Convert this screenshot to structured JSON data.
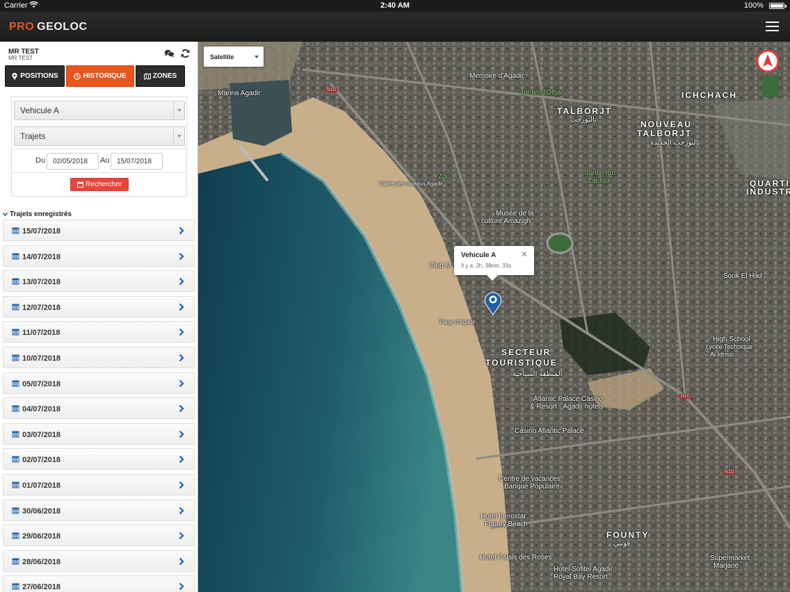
{
  "status_bar": {
    "carrier": "Carrier",
    "time": "2:40 AM",
    "battery": "100%"
  },
  "header": {
    "logo_pro": "PRO",
    "logo_geoloc": "GEOLOC"
  },
  "user": {
    "name": "MR TEST",
    "subname": "MR TEST"
  },
  "tabs": [
    {
      "label": "POSITIONS",
      "icon": "map-pin-icon"
    },
    {
      "label": "HISTORIQUE",
      "icon": "clock-icon",
      "active": true
    },
    {
      "label": "ZONES",
      "icon": "map-icon"
    }
  ],
  "filters": {
    "vehicle": "Vehicule A",
    "mode": "Trajets",
    "from_label": "Du",
    "from_value": "02/05/2018",
    "to_label": "Au",
    "to_value": "15/07/2018",
    "search_label": "Rechercher"
  },
  "trips": {
    "header": "Trajets enregistrés",
    "items": [
      "15/07/2018",
      "14/07/2018",
      "13/07/2018",
      "12/07/2018",
      "11/07/2018",
      "10/07/2018",
      "05/07/2018",
      "04/07/2018",
      "03/07/2018",
      "02/07/2018",
      "01/07/2018",
      "30/06/2018",
      "29/06/2018",
      "28/06/2018",
      "27/06/2018"
    ]
  },
  "map": {
    "type": "Satellite",
    "popup": {
      "title": "Vehicule A",
      "subtitle": "Il y a: 2h, 38mn, 33s"
    },
    "labels": {
      "marina": "Marina Agadir",
      "memoire": "Memoire d'Agadir",
      "jardin_olhao": "Jardin d'Olhao",
      "ichchach": "ICHCHACH",
      "talborjt": "TALBORJT",
      "talborjt_ar": "تالبورجت",
      "nouveau1": "NOUVEAU",
      "nouveau2": "TALBORJT",
      "nouveau_ar": "تالبورجت الجديدة",
      "zoo": "Zoo",
      "vallee": "Vallée des oiseaux Agadir",
      "jardin_ibn1": "Jardin Ibn",
      "jardin_ibn2": "Zaidoun",
      "quartier1": "QUARTIE",
      "quartier2": "INDUSTRI",
      "musee1": "Musée de la",
      "musee2": "culture Amazigh",
      "club": "Club M",
      "souk": "Souk El Had",
      "plage": "Plage d'Agadir",
      "highschool1": "High School",
      "highschool2": "Lycée Technique",
      "highschool3": "Al Idrissi",
      "secteur1": "SECTEUR",
      "secteur2": "TOURISTIQUE",
      "secteur_ar": "المنطقة السياحية",
      "atlantic1": "Atlantic Palace Casino",
      "atlantic2": "& Resort - Agadir hotels",
      "casino": "Casino Atlantic Palace",
      "centre1": "Centre de vacances",
      "centre2": "Banque Populaire",
      "iberostar1": "Hotel Iberostar",
      "iberostar2": "Founty Beach",
      "founty": "FOUNTY",
      "founty_ar": "فونتي",
      "palais": "Hotel Palais des Roses",
      "sofitel1": "Hotel Sofitel Agadir",
      "sofitel2": "Royal Bay Resort",
      "supermarket1": "Supermarket",
      "supermarket2": "Marjane",
      "n10": "N10"
    }
  }
}
